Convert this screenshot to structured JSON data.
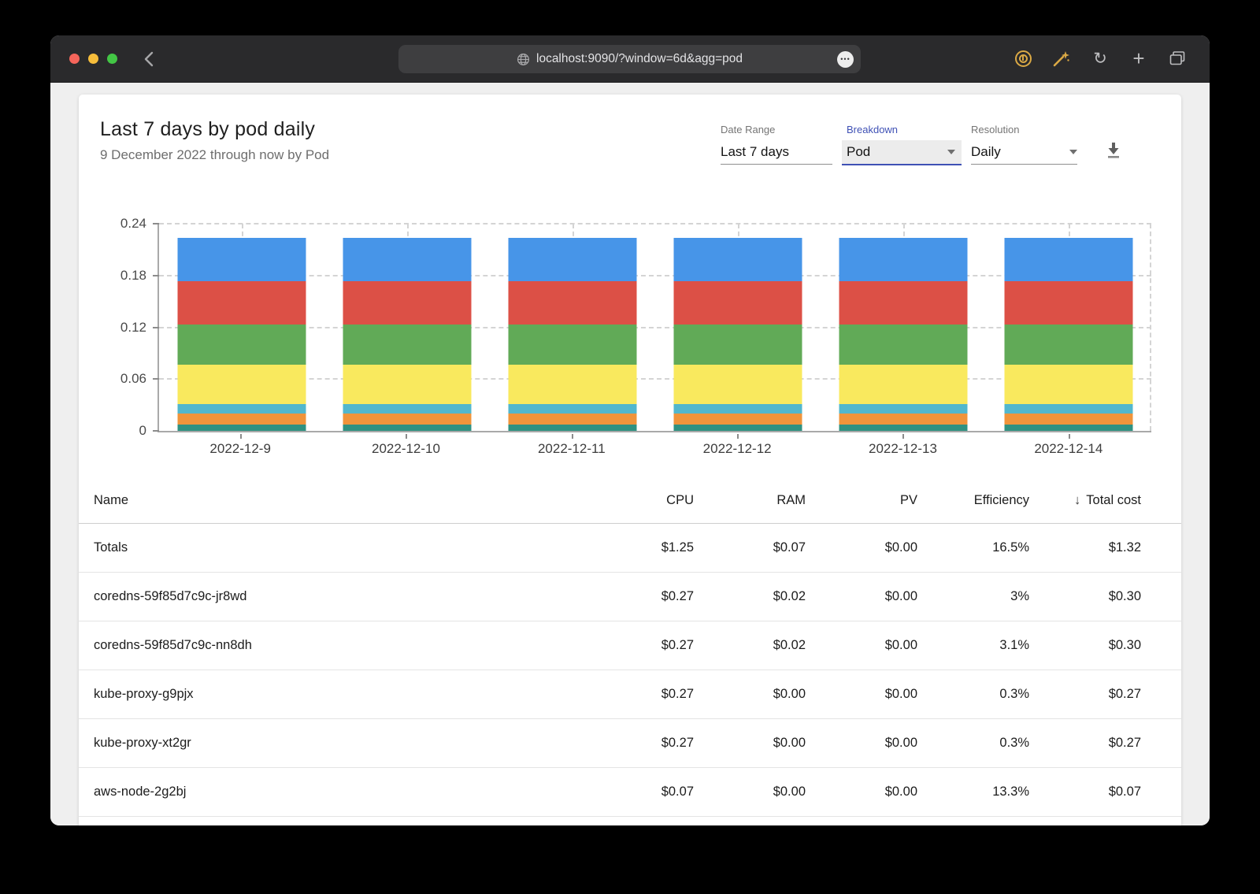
{
  "browser": {
    "url": "localhost:9090/?window=6d&agg=pod",
    "traffic_lights": [
      {
        "name": "close",
        "color": "#f5655b"
      },
      {
        "name": "minimize",
        "color": "#f6bd3b"
      },
      {
        "name": "zoom",
        "color": "#43c645"
      }
    ],
    "extension_accent": "#dba945"
  },
  "page": {
    "title": "Last 7 days by pod daily",
    "subtitle": "9 December 2022 through now by Pod",
    "accent_blue": "#3f51b5",
    "controls": {
      "date_range": {
        "label": "Date Range",
        "value": "Last 7 days"
      },
      "breakdown": {
        "label": "Breakdown",
        "value": "Pod"
      },
      "resolution": {
        "label": "Resolution",
        "value": "Daily"
      }
    }
  },
  "chart_data": {
    "type": "bar",
    "stacked": true,
    "title": "",
    "xlabel": "",
    "ylabel": "",
    "categories": [
      "2022-12-9",
      "2022-12-10",
      "2022-12-11",
      "2022-12-12",
      "2022-12-13",
      "2022-12-14"
    ],
    "series": [
      {
        "name": "segment-teal",
        "color": "#2f9181",
        "values": [
          0.007,
          0.007,
          0.007,
          0.007,
          0.007,
          0.007
        ]
      },
      {
        "name": "segment-orange",
        "color": "#f0943b",
        "values": [
          0.013,
          0.013,
          0.013,
          0.013,
          0.013,
          0.013
        ]
      },
      {
        "name": "segment-cyan",
        "color": "#52b7cd",
        "values": [
          0.011,
          0.011,
          0.011,
          0.011,
          0.011,
          0.011
        ]
      },
      {
        "name": "segment-yellow",
        "color": "#f9e95e",
        "values": [
          0.045,
          0.045,
          0.045,
          0.045,
          0.045,
          0.045
        ]
      },
      {
        "name": "segment-green",
        "color": "#61aa57",
        "values": [
          0.046,
          0.046,
          0.046,
          0.046,
          0.046,
          0.046
        ]
      },
      {
        "name": "segment-red",
        "color": "#dc5046",
        "values": [
          0.05,
          0.05,
          0.05,
          0.05,
          0.05,
          0.05
        ]
      },
      {
        "name": "segment-blue",
        "color": "#4795e8",
        "values": [
          0.05,
          0.05,
          0.05,
          0.05,
          0.05,
          0.05
        ]
      }
    ],
    "stack_order": "bottom-to-top",
    "ylim": [
      0,
      0.24
    ],
    "yticks": [
      {
        "v": 0,
        "label": "0"
      },
      {
        "v": 0.06,
        "label": "0.06"
      },
      {
        "v": 0.12,
        "label": "0.12"
      },
      {
        "v": 0.18,
        "label": "0.18"
      },
      {
        "v": 0.24,
        "label": "0.24"
      }
    ],
    "grid": true,
    "legend": "none"
  },
  "table": {
    "columns": [
      {
        "label": "Name",
        "align": "left"
      },
      {
        "label": "CPU",
        "align": "right"
      },
      {
        "label": "RAM",
        "align": "right"
      },
      {
        "label": "PV",
        "align": "right"
      },
      {
        "label": "Efficiency",
        "align": "right"
      },
      {
        "label": "Total cost",
        "align": "right",
        "sorted": "desc"
      }
    ],
    "rows": [
      [
        "Totals",
        "$1.25",
        "$0.07",
        "$0.00",
        "16.5%",
        "$1.32"
      ],
      [
        "coredns-59f85d7c9c-jr8wd",
        "$0.27",
        "$0.02",
        "$0.00",
        "3%",
        "$0.30"
      ],
      [
        "coredns-59f85d7c9c-nn8dh",
        "$0.27",
        "$0.02",
        "$0.00",
        "3.1%",
        "$0.30"
      ],
      [
        "kube-proxy-g9pjx",
        "$0.27",
        "$0.00",
        "$0.00",
        "0.3%",
        "$0.27"
      ],
      [
        "kube-proxy-xt2gr",
        "$0.27",
        "$0.00",
        "$0.00",
        "0.3%",
        "$0.27"
      ],
      [
        "aws-node-2g2bj",
        "$0.07",
        "$0.00",
        "$0.00",
        "13.3%",
        "$0.07"
      ]
    ]
  }
}
